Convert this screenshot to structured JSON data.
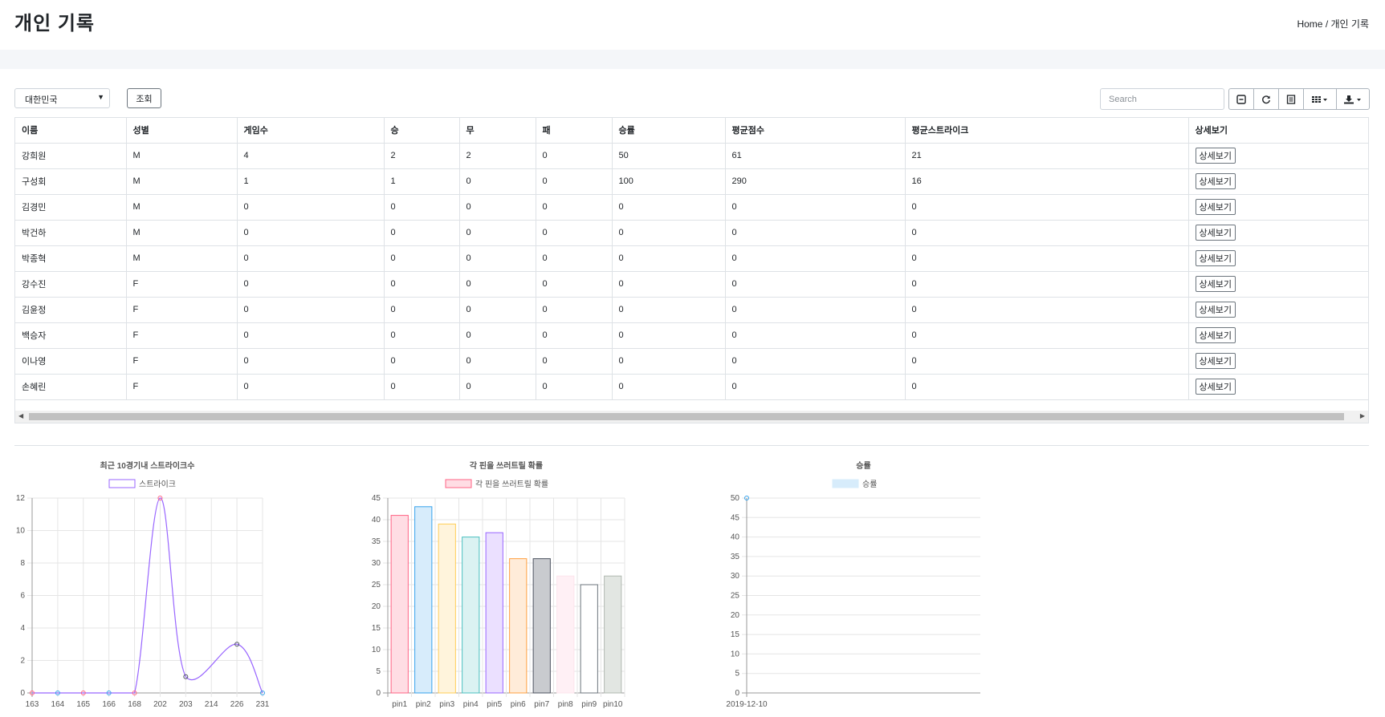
{
  "header": {
    "title": "개인 기록",
    "breadcrumb_home": "Home",
    "breadcrumb_sep": " / ",
    "breadcrumb_current": "개인 기록"
  },
  "toolbar": {
    "country": "대한민국",
    "query_label": "조회",
    "search_placeholder": "Search"
  },
  "table": {
    "columns": [
      "이름",
      "성별",
      "게임수",
      "승",
      "무",
      "패",
      "승률",
      "평균점수",
      "평균스트라이크",
      "상세보기"
    ],
    "detail_label": "상세보기",
    "rows": [
      [
        "강희원",
        "M",
        "4",
        "2",
        "2",
        "0",
        "50",
        "61",
        "21"
      ],
      [
        "구성회",
        "M",
        "1",
        "1",
        "0",
        "0",
        "100",
        "290",
        "16"
      ],
      [
        "김경민",
        "M",
        "0",
        "0",
        "0",
        "0",
        "0",
        "0",
        "0"
      ],
      [
        "박건하",
        "M",
        "0",
        "0",
        "0",
        "0",
        "0",
        "0",
        "0"
      ],
      [
        "박종혁",
        "M",
        "0",
        "0",
        "0",
        "0",
        "0",
        "0",
        "0"
      ],
      [
        "강수진",
        "F",
        "0",
        "0",
        "0",
        "0",
        "0",
        "0",
        "0"
      ],
      [
        "김윤정",
        "F",
        "0",
        "0",
        "0",
        "0",
        "0",
        "0",
        "0"
      ],
      [
        "백승자",
        "F",
        "0",
        "0",
        "0",
        "0",
        "0",
        "0",
        "0"
      ],
      [
        "이나영",
        "F",
        "0",
        "0",
        "0",
        "0",
        "0",
        "0",
        "0"
      ],
      [
        "손혜린",
        "F",
        "0",
        "0",
        "0",
        "0",
        "0",
        "0",
        "0"
      ]
    ]
  },
  "chart_data": [
    {
      "type": "line",
      "title": "최근 10경기내 스트라이크수",
      "legend": "스트라이크",
      "categories": [
        "163",
        "164",
        "165",
        "166",
        "168",
        "202",
        "203",
        "214",
        "226",
        "231"
      ],
      "values": [
        0,
        0,
        0,
        0,
        0,
        12,
        1,
        null,
        3,
        0
      ],
      "ylim": [
        0,
        12
      ],
      "yticks": [
        0,
        2,
        4,
        6,
        8,
        10,
        12
      ],
      "grid": true,
      "color": "#9966ff",
      "point_colors": [
        "#ff6384",
        "#36a2eb",
        "#ff6384",
        "#36a2eb",
        "#ff6384",
        "#ff6384",
        "#4d5360",
        "#9966ff",
        "#4d5360",
        "#36a2eb"
      ]
    },
    {
      "type": "bar",
      "title": "각 핀을 쓰러트릴 확률",
      "legend": "각 핀을 쓰러트릴 확률",
      "categories": [
        "pin1",
        "pin2",
        "pin3",
        "pin4",
        "pin5",
        "pin6",
        "pin7",
        "pin8",
        "pin9",
        "pin10"
      ],
      "values": [
        41,
        43,
        39,
        36,
        37,
        31,
        31,
        27,
        25,
        27
      ],
      "ylim": [
        0,
        45
      ],
      "yticks": [
        0,
        5,
        10,
        15,
        20,
        25,
        30,
        35,
        40,
        45
      ],
      "grid": true,
      "fills": [
        "#ffdde4",
        "#d7ecfb",
        "#fff4dc",
        "#dbf2f2",
        "#ebe0ff",
        "#ffecd9",
        "#c9cbcf",
        "#fff0f5",
        "#ffffff",
        "#e2e6e2"
      ],
      "strokes": [
        "#ff6384",
        "#36a2eb",
        "#ffce56",
        "#4bc0c0",
        "#9966ff",
        "#ff9f40",
        "#4d5360",
        "#fce4ec",
        "#6c757d",
        "#b0b8b0"
      ]
    },
    {
      "type": "line",
      "title": "승률",
      "legend": "승률",
      "categories": [
        "2019-12-10"
      ],
      "values": [
        50
      ],
      "ylim": [
        0,
        50
      ],
      "yticks": [
        0,
        5,
        10,
        15,
        20,
        25,
        30,
        35,
        40,
        45,
        50
      ],
      "grid": true,
      "color": "#36a2eb"
    }
  ]
}
